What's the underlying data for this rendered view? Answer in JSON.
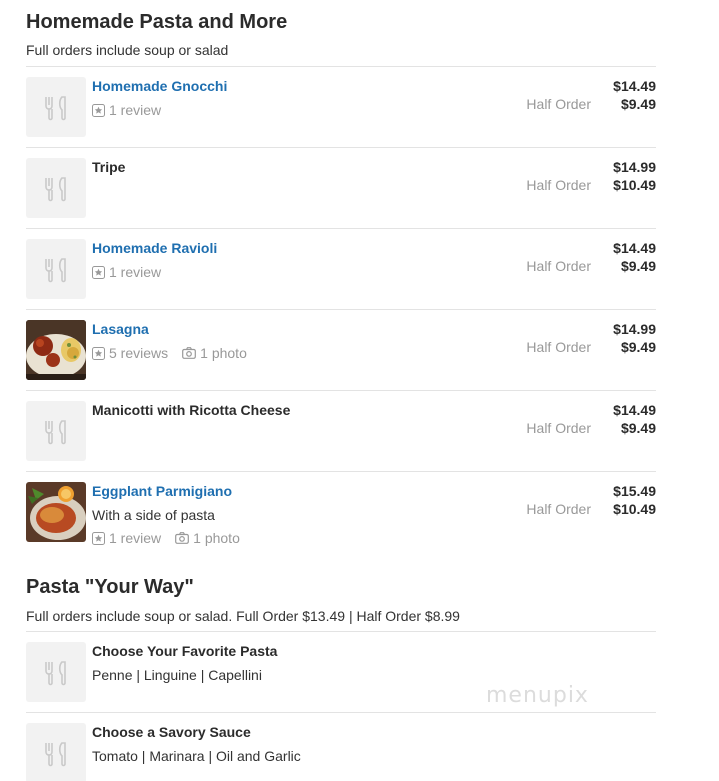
{
  "sections": [
    {
      "title": "Homemade Pasta and More",
      "description": "Full orders include soup or salad",
      "items": [
        {
          "name": "Homemade Gnocchi",
          "price": "$14.49",
          "half_label": "Half Order",
          "half_price": "$9.49",
          "reviews": "1 review",
          "photos": "",
          "desc": "",
          "image": "placeholder"
        },
        {
          "name": "Tripe",
          "price": "$14.99",
          "half_label": "Half Order",
          "half_price": "$10.49",
          "reviews": "",
          "photos": "",
          "desc": "",
          "image": "placeholder"
        },
        {
          "name": "Homemade Ravioli",
          "price": "$14.49",
          "half_label": "Half Order",
          "half_price": "$9.49",
          "reviews": "1 review",
          "photos": "",
          "desc": "",
          "image": "placeholder"
        },
        {
          "name": "Lasagna",
          "price": "$14.99",
          "half_label": "Half Order",
          "half_price": "$9.49",
          "reviews": "5 reviews",
          "photos": "1 photo",
          "desc": "",
          "image": "lasagna-photo"
        },
        {
          "name": "Manicotti with Ricotta Cheese",
          "price": "$14.49",
          "half_label": "Half Order",
          "half_price": "$9.49",
          "reviews": "",
          "photos": "",
          "desc": "",
          "image": "placeholder"
        },
        {
          "name": "Eggplant Parmigiano",
          "price": "$15.49",
          "half_label": "Half Order",
          "half_price": "$10.49",
          "reviews": "1 review",
          "photos": "1 photo",
          "desc": "With a side of pasta",
          "image": "eggplant-photo"
        }
      ]
    },
    {
      "title": "Pasta \"Your Way\"",
      "description": "Full orders include soup or salad. Full Order $13.49 | Half Order $8.99",
      "items": [
        {
          "name": "Choose Your Favorite Pasta",
          "desc": "Penne | Linguine | Capellini",
          "image": "placeholder"
        },
        {
          "name": "Choose a Savory Sauce",
          "desc": "Tomato | Marinara | Oil and Garlic",
          "image": "placeholder"
        }
      ]
    }
  ],
  "watermark": "menupix",
  "colors": {
    "link": "#1f6fb0",
    "muted": "#999999",
    "divider": "#e3e3e3",
    "placeholder_bg": "#f2f2f2"
  },
  "icons": {
    "placeholder": "fork-knife-icon",
    "reviews": "star-icon",
    "photos": "camera-icon"
  }
}
